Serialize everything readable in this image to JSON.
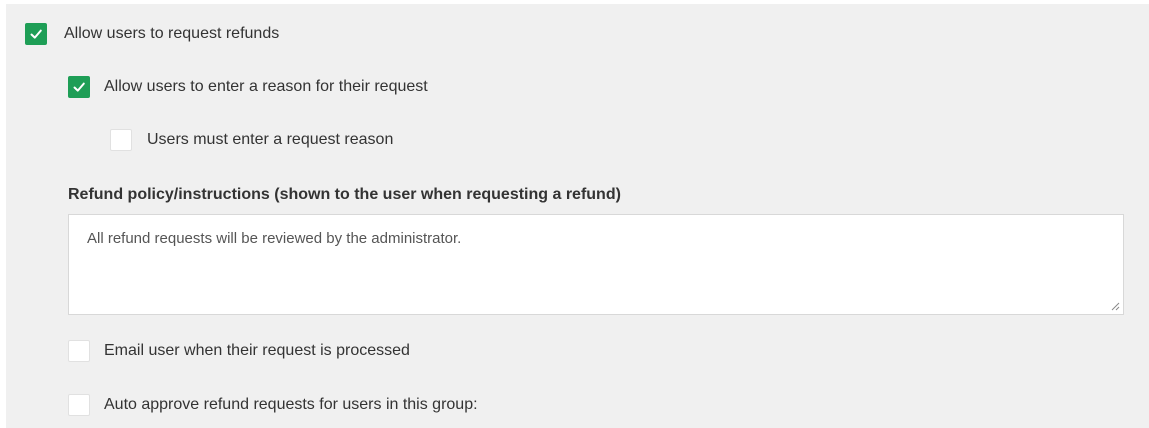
{
  "settings": {
    "allow_refunds": {
      "label": "Allow users to request refunds",
      "checked": true
    },
    "allow_reason": {
      "label": "Allow users to enter a reason for their request",
      "checked": true
    },
    "require_reason": {
      "label": "Users must enter a request reason",
      "checked": false
    },
    "refund_policy": {
      "heading": "Refund policy/instructions (shown to the user when requesting a refund)",
      "value": "All refund requests will be reviewed by the administrator."
    },
    "email_user": {
      "label": "Email user when their request is processed",
      "checked": false
    },
    "auto_approve": {
      "label": "Auto approve refund requests for users in this group:",
      "checked": false
    }
  },
  "colors": {
    "checked": "#1e9e56",
    "panel_background": "#f0f0f0"
  },
  "icons": {
    "checkmark": "check-icon",
    "resize": "resize-grip-icon"
  }
}
